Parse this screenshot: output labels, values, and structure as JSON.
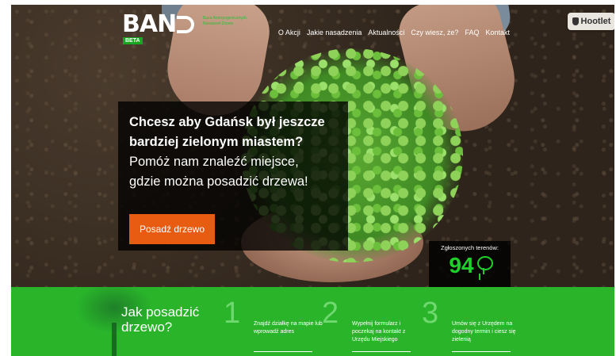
{
  "logo": {
    "text": "BAN",
    "beta": "BETA",
    "subtitle": "Baza Antropogenicznych Nasadzeń Drzew"
  },
  "nav": {
    "items": [
      "O Akcji",
      "Jakie nasadzenia",
      "Aktualności",
      "Czy wiesz, że?",
      "FAQ",
      "Kontakt"
    ]
  },
  "hootlet": {
    "label": "Hootlet"
  },
  "promo": {
    "line1": "Chcesz aby Gdańsk był jeszcze",
    "line2": "bardziej zielonym miastem?",
    "line3": "Pomóż nam znaleźć miejsce,",
    "line4": "gdzie można posadzić drzewa!",
    "cta": "Posadź drzewo"
  },
  "counter": {
    "label": "Zgłoszonych terenów:",
    "value": "94"
  },
  "steps": {
    "title": "Jak posadzić drzewo?",
    "items": [
      {
        "num": "1",
        "text": "Znajdź działkę na mapie lub wprowadź adres"
      },
      {
        "num": "2",
        "text": "Wypełnij formularz i poczekaj na kontakt z Urzędu Miejskiego"
      },
      {
        "num": "3",
        "text": "Umów się z Urzędem na dogodny termin i ciesz się zielenią"
      }
    ]
  },
  "colors": {
    "accent_green": "#29b42a",
    "cta_orange": "#e85c11",
    "counter_green": "#1fd02a"
  }
}
